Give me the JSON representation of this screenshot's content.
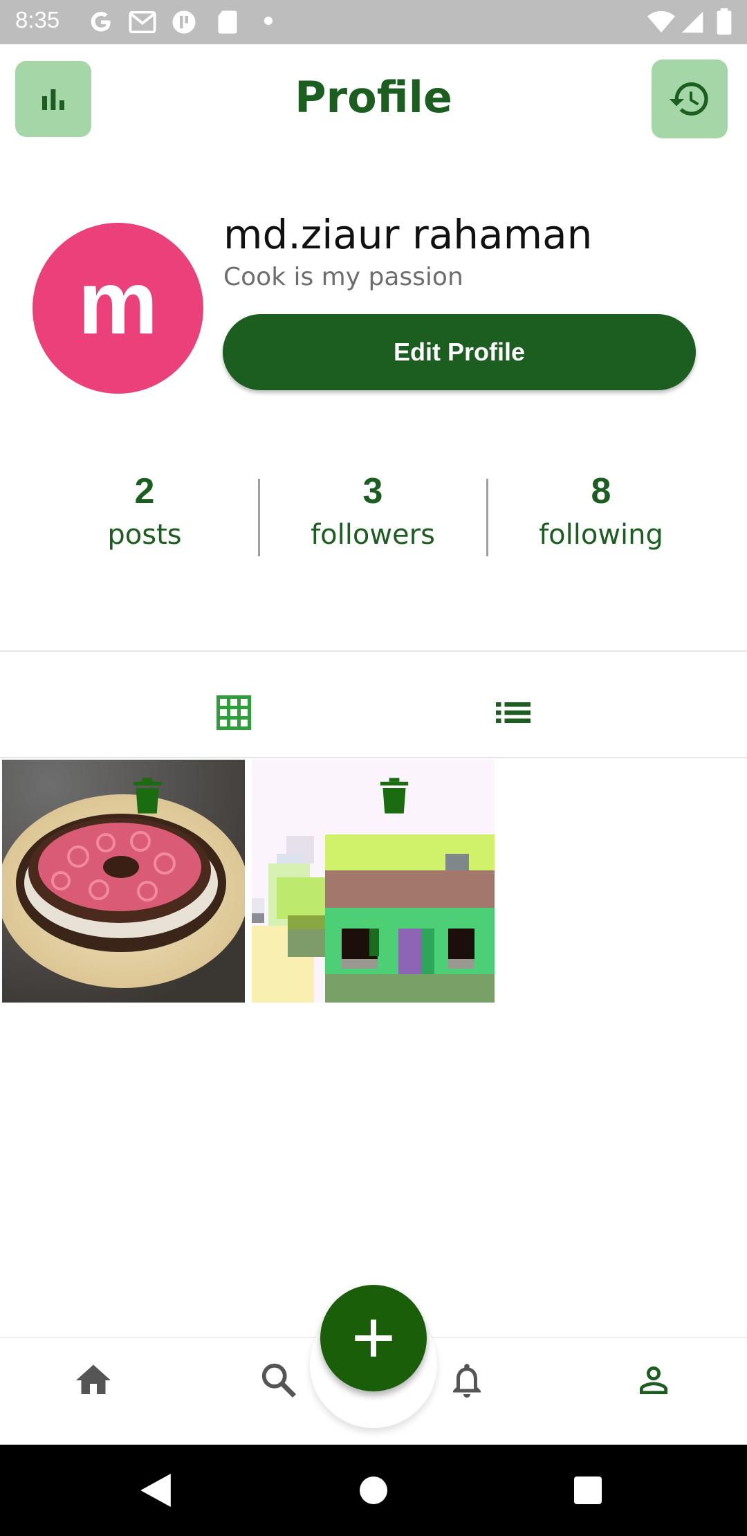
{
  "status_bar": {
    "time": "8:35",
    "left_icons": [
      "google-icon",
      "gmail-icon",
      "app-icon",
      "sd-card-icon",
      "dot-icon"
    ],
    "right_icons": [
      "wifi-icon",
      "signal-icon",
      "battery-icon"
    ]
  },
  "header": {
    "title": "Profile",
    "left_button_icon": "bar-chart-icon",
    "right_button_icon": "history-icon"
  },
  "profile": {
    "avatar_letter": "m",
    "avatar_color": "#ec407a",
    "name": "md.ziaur rahaman",
    "bio": "Cook is my passion",
    "edit_label": "Edit Profile"
  },
  "stats": [
    {
      "value": "2",
      "label": "posts"
    },
    {
      "value": "3",
      "label": "followers"
    },
    {
      "value": "8",
      "label": "following"
    }
  ],
  "tabs": [
    {
      "icon": "grid-icon",
      "active": true
    },
    {
      "icon": "list-icon",
      "active": false
    }
  ],
  "posts": [
    {
      "image": "cake-photo",
      "action_icon": "delete-icon"
    },
    {
      "image": "pixel-house-image",
      "action_icon": "delete-icon"
    }
  ],
  "bottom_nav": [
    {
      "icon": "home-icon"
    },
    {
      "icon": "search-icon"
    },
    {
      "icon": "bell-icon"
    },
    {
      "icon": "person-icon",
      "active": true
    }
  ],
  "fab_icon": "plus-icon",
  "colors": {
    "primary": "#1b5e20",
    "accent_light": "#a5d6a7",
    "avatar": "#ec407a"
  }
}
